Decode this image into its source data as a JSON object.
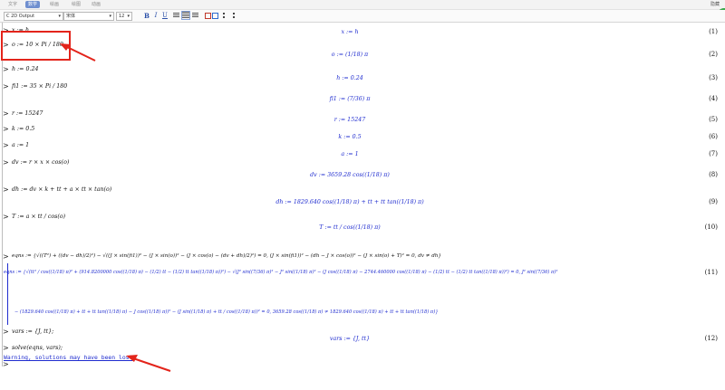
{
  "menu": {
    "tabs": [
      "文字",
      "数学",
      "绘画",
      "绘图",
      "动画"
    ],
    "active_tab": 1,
    "right_label": "隐藏"
  },
  "toolbar": {
    "style_select": "C  2D Output",
    "font_select": "宋体",
    "size_select": "12",
    "bold": "B",
    "italic": "I",
    "underline": "U"
  },
  "worksheet": {
    "rows": [
      {
        "prompt": ">",
        "input": "x := h",
        "output": "x := h",
        "eq": "(1)"
      },
      {
        "prompt": ">",
        "input": "o := 10 × Pi / 180",
        "output": "o := (1/18) π",
        "eq": "(2)"
      },
      {
        "prompt": ">",
        "input": "h := 0.24",
        "output": "h := 0.24",
        "eq": "(3)"
      },
      {
        "prompt": ">",
        "input": "fi1 := 35 × Pi / 180",
        "output": "fi1 := (7/36) π",
        "eq": "(4)"
      },
      {
        "prompt": ">",
        "input": "r := 15247",
        "output": "r := 15247",
        "eq": "(5)"
      },
      {
        "prompt": ">",
        "input": "k := 0.5",
        "output": "k := 0.5",
        "eq": "(6)"
      },
      {
        "prompt": ">",
        "input": "a := 1",
        "output": "a := 1",
        "eq": "(7)"
      },
      {
        "prompt": ">",
        "input": "dv := r × x × cos(o)",
        "output": "dv := 3659.28 cos((1/18) π)",
        "eq": "(8)"
      },
      {
        "prompt": ">",
        "input": "dh := dv × k + tt + a × tt × tan(o)",
        "output": "dh := 1829.640 cos((1/18) π) + tt + tt tan((1/18) π)",
        "eq": "(9)"
      },
      {
        "prompt": ">",
        "input": "T := a × tt / cos(o)",
        "output": "T := tt / cos((1/18) π)",
        "eq": "(10)"
      },
      {
        "prompt": ">",
        "input": "eqns := {√((T²) + ((dv − dh)/2)²) − √((J × sin(fi1))² − (J × sin(o))² − (J × cos(o) − (dv + dh)/2)²) = 0, (J × sin(fi1))² − (dh − J × cos(o))² − (J × sin(o) + T)² = 0, dv ≠ dh}",
        "output": "",
        "eq": ""
      },
      {
        "prompt": "",
        "input": "",
        "output": "eqns := {√(tt² / cos((1/18) π)² + (914.8200000 cos((1/18) π) − (1/2) tt − (1/2) tt tan((1/18) π))²) − √(J² sin((7/36) π)² − J² sin((1/18) π)² − (J cos((1/18) π) − 2744.460000 cos((1/18) π) − (1/2) tt − (1/2) tt tan((1/18) π))²) = 0, J² sin((7/36) π)²",
        "eq": "(11)"
      },
      {
        "prompt": "",
        "input": "",
        "output": "− (1829.640 cos((1/18) π) + tt + tt tan((1/18) π) − J cos((1/18) π))² − (J sin((1/18) π) + tt / cos((1/18) π))² = 0, 3659.28 cos((1/18) π) ≠ 1829.640 cos((1/18) π) + tt + tt tan((1/18) π)}",
        "eq": ""
      },
      {
        "prompt": ">",
        "input": "vars := {J, tt};",
        "output": "vars := {J, tt}",
        "eq": "(12)"
      },
      {
        "prompt": ">",
        "input": "solve(eqns, vars);",
        "output": "",
        "eq": ""
      }
    ],
    "warning": "Warning, solutions may have been lost",
    "final_prompt": ">"
  },
  "colors": {
    "output": "#1f2ccf",
    "annotation": "#e3241b",
    "active_tab": "#6f8fcf"
  },
  "icons": [
    "align-left-icon",
    "align-center-icon",
    "align-right-icon",
    "bullet-list-icon",
    "numbered-list-icon"
  ]
}
